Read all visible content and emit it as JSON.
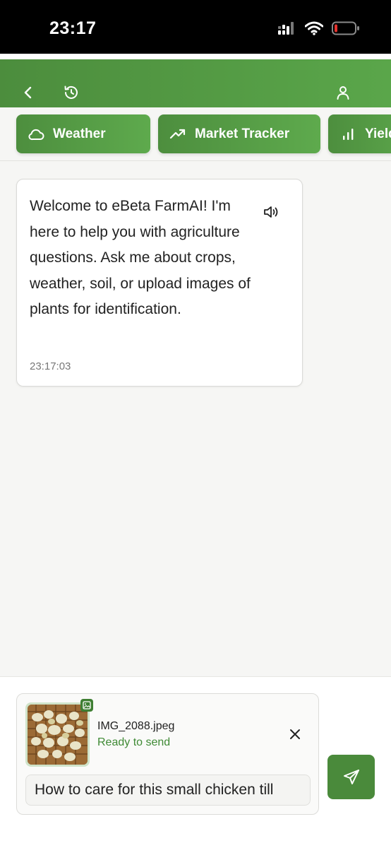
{
  "status_bar": {
    "time": "23:17",
    "icons": [
      "signal-icon",
      "wifi-icon",
      "battery-icon"
    ]
  },
  "header": {
    "icons": [
      "back-icon",
      "history-icon",
      "profile-icon"
    ],
    "accent": "#4c8d3d"
  },
  "quick_actions": [
    {
      "label": "Weather",
      "icon": "cloud-icon"
    },
    {
      "label": "Market Tracker",
      "icon": "trending-up-icon"
    },
    {
      "label": "Yield",
      "icon": "bar-chart-icon"
    }
  ],
  "messages": [
    {
      "text": "Welcome to eBeta FarmAI! I'm here to help you with agriculture questions. Ask me about crops, weather, soil, or upload images of plants for identification.",
      "timestamp": "23:17:03",
      "icon": "speaker-icon"
    }
  ],
  "composer": {
    "attachment": {
      "file_name": "IMG_2088.jpeg",
      "status": "Ready to send"
    },
    "input_value": "How to care for this small chicken till",
    "send_icon": "send-icon",
    "remove_icon": "close-icon"
  }
}
